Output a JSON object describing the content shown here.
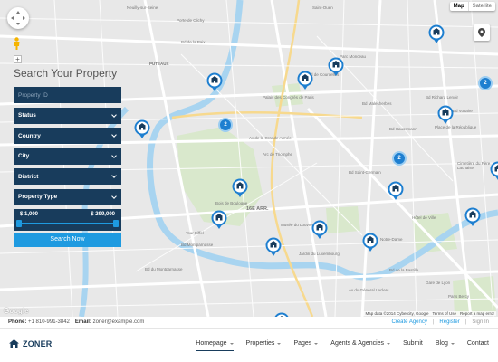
{
  "map": {
    "type_toggle": {
      "map": "Map",
      "satellite": "Satellite"
    },
    "labels": [
      "PUTEAUX",
      "Bd de la Paix",
      "Neuilly-sur-Seine",
      "Palais des Congrès de Paris",
      "Bd de Courcelles",
      "Parc Monceau",
      "Bd Malesherbes",
      "Bd Haussmann",
      "Av de la Grande Armée",
      "Arc de Triomphe",
      "Bd Richard Lenoir",
      "Bd Voltaire",
      "Saint-Ouen",
      "Bois de Boulogne",
      "16E ARR.",
      "Musée du Louvre",
      "Hôtel de Ville",
      "Notre-Dame",
      "Bd Saint-Germain",
      "Bd Montparnasse",
      "Tour Eiffel",
      "Jardin du Luxembourg",
      "Bd du Montparnasse",
      "Av du Général Leclerc",
      "Porte de Clichy",
      "Place de la République",
      "Cimetière du Père Lachaise",
      "Bd de la Bastille",
      "Gare de Lyon",
      "Paris Bercy"
    ],
    "clusters": [
      "2",
      "2",
      "2"
    ],
    "markers": [
      "building-icon",
      "house-icon",
      "apartment-icon",
      "villa-icon",
      "office-icon",
      "building-icon",
      "apartment-icon",
      "house-icon",
      "building-icon",
      "office-icon",
      "villa-icon",
      "house-icon",
      "apartment-icon",
      "building-icon",
      "office-icon"
    ],
    "attribution": {
      "data": "Map data ©2014 Cybercity, Google",
      "terms": "Terms of Use",
      "report": "Report a map error"
    },
    "google_logo": "Google"
  },
  "search": {
    "title": "Search Your Property",
    "property_id_placeholder": "Property ID",
    "fields": [
      "Status",
      "Country",
      "City",
      "District",
      "Property Type"
    ],
    "price_min": "$ 1,000",
    "price_max": "$ 299,000",
    "price_range_fraction": [
      0.0,
      1.0
    ],
    "button": "Search Now"
  },
  "topbar": {
    "phone_label": "Phone:",
    "phone": "+1 810-991-3842",
    "email_label": "Email:",
    "email": "zoner@example.com",
    "create_agency": "Create Agency",
    "register": "Register",
    "sign_in": "Sign In"
  },
  "nav": {
    "logo": "ZONER",
    "items": [
      "Homepage",
      "Properties",
      "Pages",
      "Agents & Agencies",
      "Submit",
      "Blog",
      "Contact"
    ],
    "active": "Homepage",
    "has_caret": [
      true,
      true,
      true,
      true,
      false,
      true,
      false
    ]
  },
  "colors": {
    "navy": "#183c5c",
    "accent": "#1e9ae0",
    "cluster": "#1e7fd0",
    "map_bg": "#e8e8e8",
    "water": "#a8d4f0",
    "park": "#d4e5c8"
  }
}
